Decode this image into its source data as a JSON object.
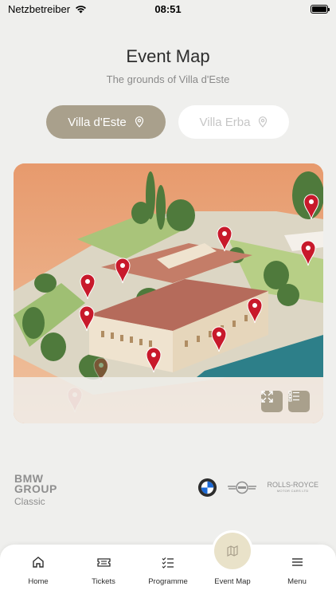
{
  "status_bar": {
    "carrier": "Netzbetreiber",
    "time": "08:51"
  },
  "header": {
    "title": "Event Map",
    "subtitle": "The grounds of Villa d'Este"
  },
  "location_toggle": {
    "options": [
      {
        "label": "Villa d'Este",
        "selected": true
      },
      {
        "label": "Villa Erba",
        "selected": false
      }
    ]
  },
  "map": {
    "pin_color": "#c8192b",
    "accent": "#a9a08c"
  },
  "logos": {
    "bmw_group": [
      "BMW",
      "GROUP"
    ],
    "classic": "Classic",
    "brands": [
      "BMW",
      "MINI",
      "Rolls-Royce"
    ],
    "rolls_royce": "ROLLS-ROYCE",
    "rolls_royce_sub": "MOTOR CARS LTD"
  },
  "tabbar": {
    "tabs": [
      {
        "label": "Home",
        "icon": "home-icon"
      },
      {
        "label": "Tickets",
        "icon": "ticket-icon"
      },
      {
        "label": "Programme",
        "icon": "checklist-icon"
      },
      {
        "label": "Event Map",
        "icon": "map-icon",
        "active": true
      },
      {
        "label": "Menu",
        "icon": "menu-icon"
      }
    ]
  }
}
